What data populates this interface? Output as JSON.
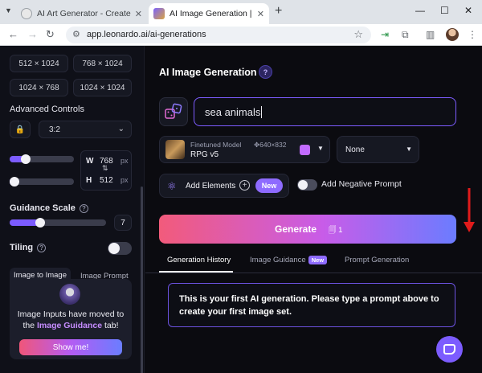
{
  "browser": {
    "tabs": [
      {
        "title": "AI Art Generator - Create Art, Im",
        "active": false
      },
      {
        "title": "AI Image Generation | Leonardo",
        "active": true
      }
    ],
    "url": "app.leonardo.ai/ai-generations",
    "new_tab": "+",
    "close_glyph": "✕"
  },
  "sidebar": {
    "dimensions": [
      "512 × 1024",
      "768 × 1024",
      "1024 × 768",
      "1024 × 1024"
    ],
    "advanced_controls_label": "Advanced Controls",
    "aspect_ratio": "3:2",
    "width": {
      "label": "W",
      "value": "768",
      "unit": "px"
    },
    "height": {
      "label": "H",
      "value": "512",
      "unit": "px"
    },
    "guidance_scale_label": "Guidance Scale",
    "guidance_value": "7",
    "tiling_label": "Tiling",
    "tabs": {
      "image_to_image": "Image to Image",
      "image_prompt": "Image Prompt"
    },
    "migrate": {
      "text_before": "Image Inputs have moved to the",
      "highlight": "Image Guidance",
      "text_after": "tab!",
      "button": "Show me!"
    }
  },
  "main": {
    "title": "AI Image Generation",
    "help_glyph": "?",
    "prompt_value": "sea animals",
    "model": {
      "subtitle": "Finetuned Model",
      "size": "640×832",
      "name": "RPG v5"
    },
    "style_select": "None",
    "add_elements_label": "Add Elements",
    "new_badge": "New",
    "negative_prompt_label": "Add Negative Prompt",
    "generate": {
      "label": "Generate",
      "tokens": "1"
    },
    "history_tabs": {
      "generation_history": "Generation History",
      "image_guidance": "Image Guidance",
      "image_guidance_badge": "New",
      "prompt_generation": "Prompt Generation"
    },
    "first_generation_msg": "This is your first AI generation. Please type a prompt above to create your first image set."
  },
  "colors": {
    "accent": "#7c5cff",
    "annotation_arrow": "#e01b1b"
  },
  "controls": {
    "dimension_slider_fraction": 0.2,
    "height_slider_fraction": 0.0,
    "guidance_slider_fraction": 0.3,
    "tiling_on": false,
    "negative_prompt_on": false
  },
  "icons": [
    "menu-chevron-icon",
    "back-icon",
    "forward-icon",
    "reload-icon",
    "site-settings-icon",
    "star-icon",
    "extension-icon",
    "puzzle-icon",
    "sidebar-icon",
    "profile-avatar",
    "kebab-icon",
    "lock-icon",
    "dice-icon",
    "atom-icon",
    "plus-icon",
    "token-icon",
    "chat-icon",
    "swap-icon"
  ]
}
